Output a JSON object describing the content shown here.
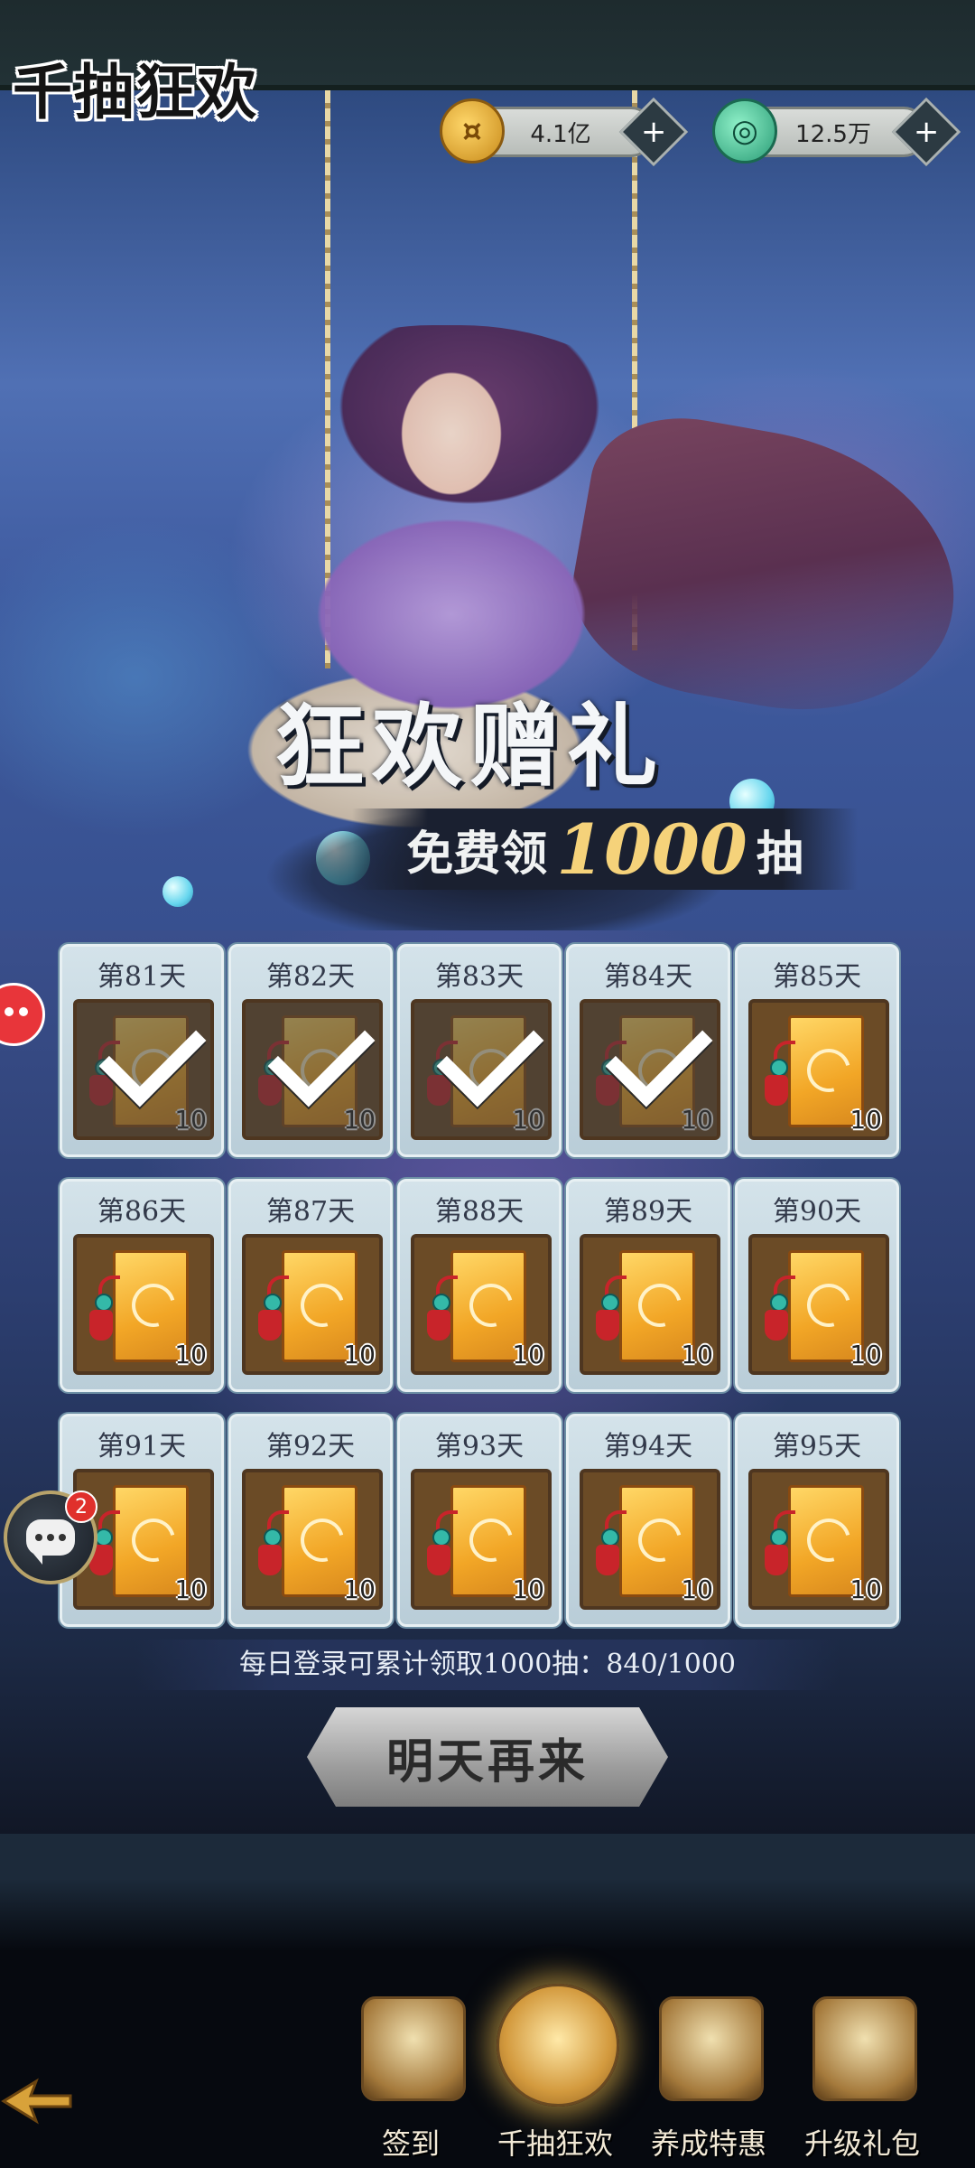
{
  "header": {
    "event_title": "千抽狂欢",
    "currencies": [
      {
        "name": "coin",
        "value": "4.1亿",
        "icon": "coin-icon",
        "color": "#d8a22a"
      },
      {
        "name": "jade",
        "value": "12.5万",
        "icon": "jade-icon",
        "color": "#3bb08c"
      }
    ],
    "plus_label": "+"
  },
  "banner": {
    "title": "狂欢赠礼",
    "subtitle_prefix": "免费领",
    "subtitle_number": "1000",
    "subtitle_suffix": "抽"
  },
  "rewards": [
    {
      "day": "第81天",
      "qty": "10",
      "claimed": true
    },
    {
      "day": "第82天",
      "qty": "10",
      "claimed": true
    },
    {
      "day": "第83天",
      "qty": "10",
      "claimed": true
    },
    {
      "day": "第84天",
      "qty": "10",
      "claimed": true
    },
    {
      "day": "第85天",
      "qty": "10",
      "claimed": false
    },
    {
      "day": "第86天",
      "qty": "10",
      "claimed": false
    },
    {
      "day": "第87天",
      "qty": "10",
      "claimed": false
    },
    {
      "day": "第88天",
      "qty": "10",
      "claimed": false
    },
    {
      "day": "第89天",
      "qty": "10",
      "claimed": false
    },
    {
      "day": "第90天",
      "qty": "10",
      "claimed": false
    },
    {
      "day": "第91天",
      "qty": "10",
      "claimed": false
    },
    {
      "day": "第92天",
      "qty": "10",
      "claimed": false
    },
    {
      "day": "第93天",
      "qty": "10",
      "claimed": false
    },
    {
      "day": "第94天",
      "qty": "10",
      "claimed": false
    },
    {
      "day": "第95天",
      "qty": "10",
      "claimed": false
    }
  ],
  "progress": {
    "text": "每日登录可累计领取1000抽：840/1000",
    "current": 840,
    "total": 1000
  },
  "action_button": {
    "label": "明天再来"
  },
  "chat": {
    "badge_count": "2",
    "icon": "chat-icon"
  },
  "bottom_nav": [
    {
      "label": "签到",
      "icon": "sign-in-icon",
      "active": false
    },
    {
      "label": "千抽狂欢",
      "icon": "thousand-draw-icon",
      "active": true
    },
    {
      "label": "养成特惠",
      "icon": "growth-deal-icon",
      "active": false
    },
    {
      "label": "升级礼包",
      "icon": "upgrade-gift-icon",
      "active": false
    }
  ]
}
